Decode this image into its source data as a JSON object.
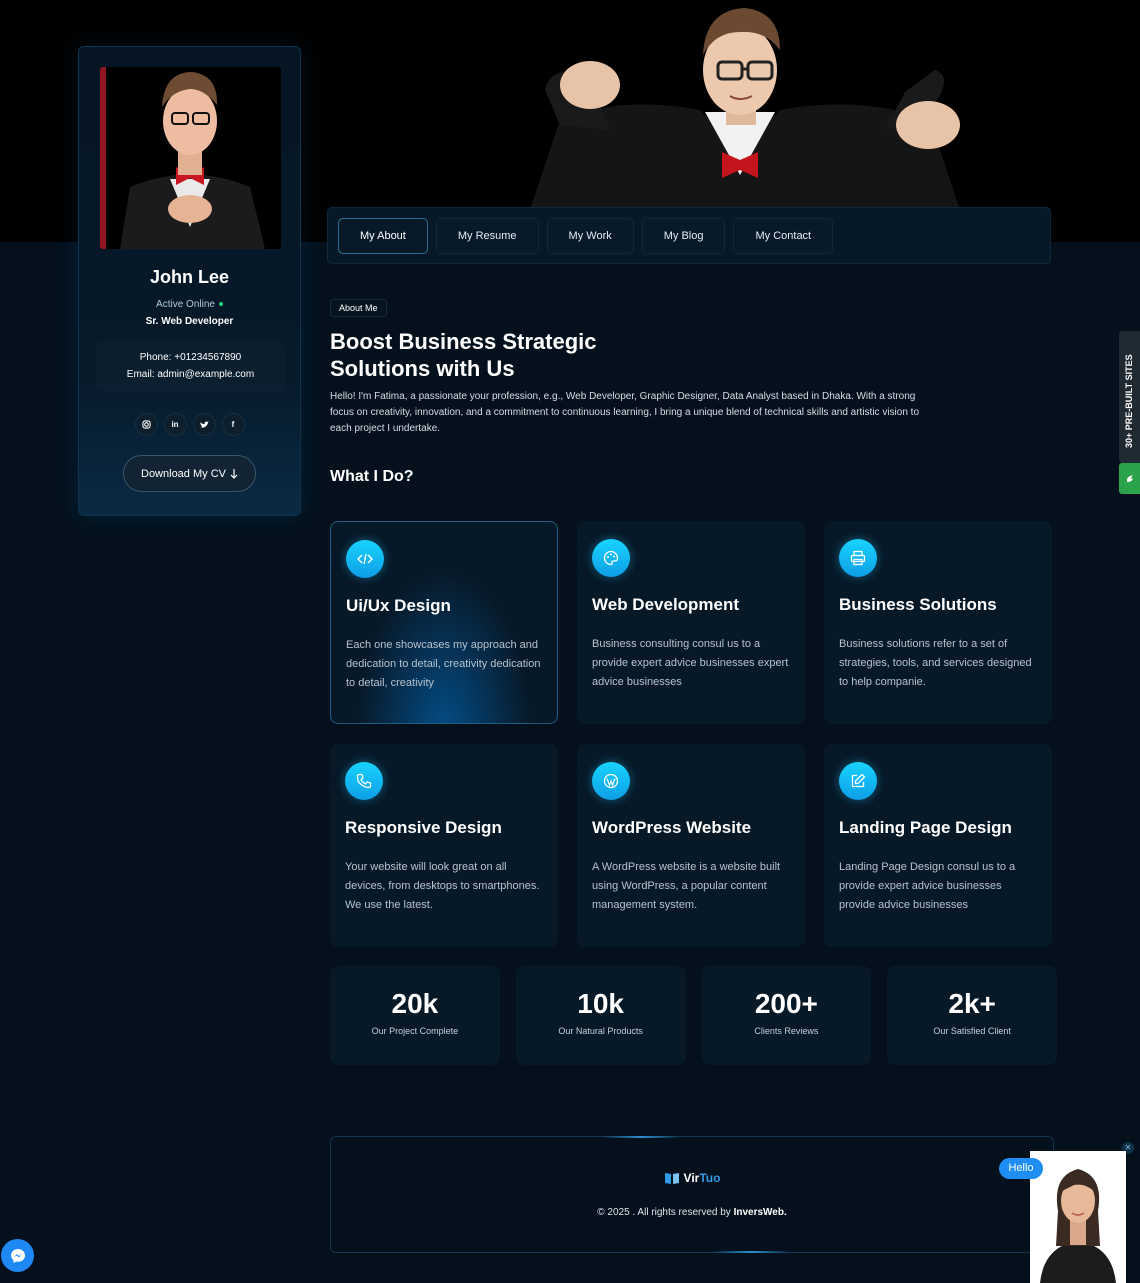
{
  "profile": {
    "name": "John Lee",
    "status": "Active Online",
    "role": "Sr. Web Developer",
    "phone": "Phone: +01234567890",
    "email": "Email: admin@example.com",
    "socials": [
      "instagram-icon",
      "linkedin-icon",
      "twitter-icon",
      "facebook-icon"
    ],
    "cv_button": "Download My CV"
  },
  "nav": {
    "tabs": [
      {
        "label": "My About",
        "active": true
      },
      {
        "label": "My Resume",
        "active": false
      },
      {
        "label": "My Work",
        "active": false
      },
      {
        "label": "My Blog",
        "active": false
      },
      {
        "label": "My Contact",
        "active": false
      }
    ]
  },
  "about": {
    "tag": "About Me",
    "title_line1": "Boost Business Strategic",
    "title_line2": "Solutions with Us",
    "text": "Hello! I'm Fatima, a passionate your profession, e.g., Web Developer, Graphic Designer, Data Analyst based in Dhaka. With a strong focus on creativity, innovation, and a commitment to continuous learning, I bring a unique blend of technical skills and artistic vision to each project I undertake."
  },
  "services": {
    "heading": "What I Do?",
    "items": [
      {
        "icon": "code-icon",
        "title": "Ui/Ux Design",
        "desc": "Each one showcases my approach and dedication to detail, creativity dedication to detail, creativity"
      },
      {
        "icon": "palette-icon",
        "title": "Web Development",
        "desc": "Business consulting consul us to a provide expert advice businesses expert advice businesses"
      },
      {
        "icon": "printer-icon",
        "title": "Business Solutions",
        "desc": "Business solutions refer to a set of strategies, tools, and services designed to help companie."
      },
      {
        "icon": "phone-icon",
        "title": "Responsive Design",
        "desc": "Your website will look great on all devices, from desktops to smartphones. We use the latest."
      },
      {
        "icon": "wordpress-icon",
        "title": "WordPress Website",
        "desc": "A WordPress website is a website built using WordPress, a popular content management system."
      },
      {
        "icon": "edit-icon",
        "title": "Landing Page Design",
        "desc": "Landing Page Design consul us to a provide expert advice businesses provide advice businesses"
      }
    ]
  },
  "stats": [
    {
      "value": "20k",
      "label": "Our Project Complete"
    },
    {
      "value": "10k",
      "label": "Our Natural Products"
    },
    {
      "value": "200+",
      "label": "Clients Reviews"
    },
    {
      "value": "2k+",
      "label": "Our Satisfied Client"
    }
  ],
  "footer": {
    "logo_a": "Vir",
    "logo_b": "Tuo",
    "copy_prefix": "© 2025 . All rights reserved by",
    "copy_brand": "InversWeb."
  },
  "side_promo": {
    "label": "30+ PRE-BUILT SITES"
  },
  "hello_widget": {
    "bubble": "Hello"
  },
  "colors": {
    "accent": "#18d4ff",
    "background": "#04111c",
    "card": "#071827",
    "promo_green": "#2aa34a",
    "messenger": "#1e88f5"
  }
}
